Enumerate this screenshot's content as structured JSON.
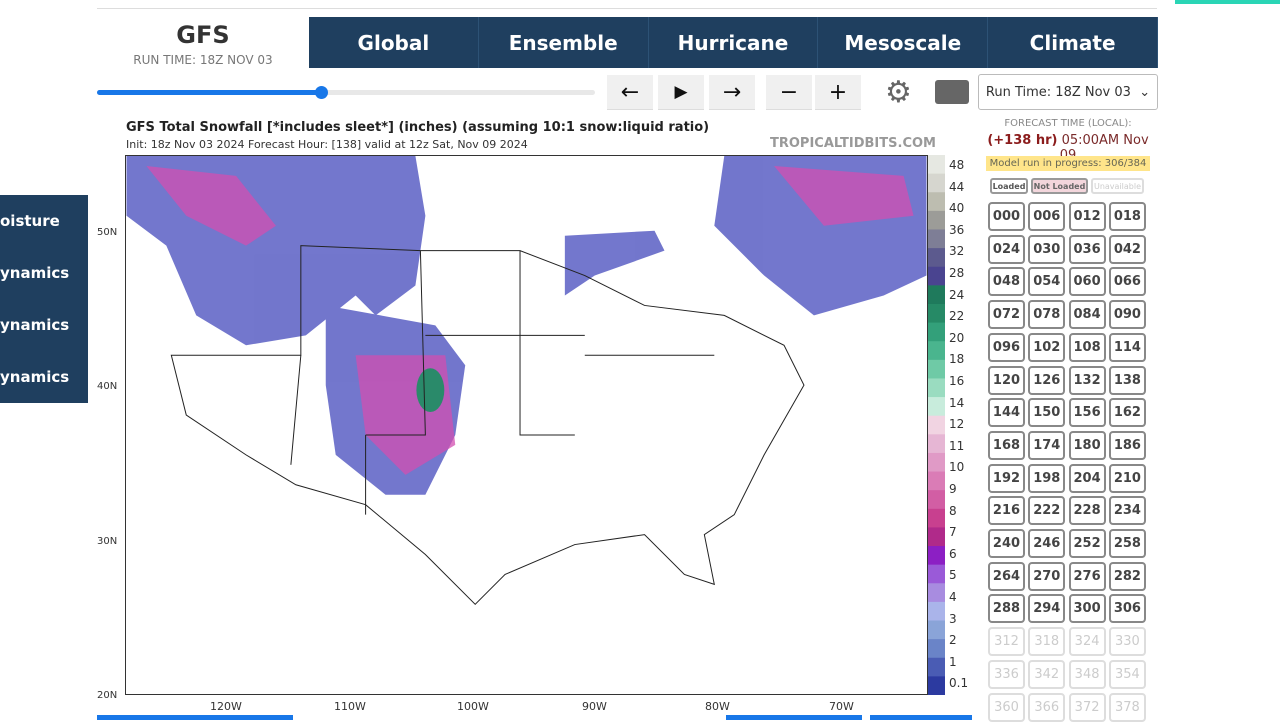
{
  "header": {
    "model": "GFS",
    "run_time": "RUN TIME: 18Z NOV 03"
  },
  "nav": [
    "Global",
    "Ensemble",
    "Hurricane",
    "Mesoscale",
    "Climate"
  ],
  "slider": {
    "progress_percent": 45
  },
  "controls": {
    "prev": "←",
    "play": "▶",
    "next": "→",
    "minus": "−",
    "plus": "+",
    "settings_icon": "gear-icon",
    "keyboard_icon": "keyboard-icon"
  },
  "run_select": "Run Time: 18Z Nov 03",
  "map": {
    "title": "GFS Total Snowfall [*includes sleet*] (inches) (assuming 10:1 snow:liquid ratio)",
    "subtitle": "Init: 18z Nov 03 2024   Forecast Hour: [138]   valid at 12z Sat, Nov 09 2024",
    "site": "TROPICALTIDBITS.COM",
    "lat_labels": [
      "50N",
      "40N",
      "30N",
      "20N"
    ],
    "lon_labels": [
      "120W",
      "110W",
      "100W",
      "90W",
      "80W",
      "70W"
    ],
    "colorbar_labels": [
      "48",
      "44",
      "40",
      "36",
      "32",
      "28",
      "24",
      "22",
      "20",
      "18",
      "16",
      "14",
      "12",
      "11",
      "10",
      "9",
      "8",
      "7",
      "6",
      "5",
      "4",
      "3",
      "2",
      "1",
      "0.1"
    ]
  },
  "forecast": {
    "label": "FORECAST TIME (LOCAL):",
    "hour": "(+138 hr)",
    "time": "05:00AM Nov 09",
    "progress": "Model run in progress: 306/384"
  },
  "legend": [
    "Loaded",
    "Not Loaded",
    "Unavailable"
  ],
  "hours_available": [
    "000",
    "006",
    "012",
    "018",
    "024",
    "030",
    "036",
    "042",
    "048",
    "054",
    "060",
    "066",
    "072",
    "078",
    "084",
    "090",
    "096",
    "102",
    "108",
    "114",
    "120",
    "126",
    "132",
    "138",
    "144",
    "150",
    "156",
    "162",
    "168",
    "174",
    "180",
    "186",
    "192",
    "198",
    "204",
    "210",
    "216",
    "222",
    "228",
    "234",
    "240",
    "246",
    "252",
    "258",
    "264",
    "270",
    "276",
    "282",
    "288",
    "294",
    "300",
    "306"
  ],
  "hours_unavailable": [
    "312",
    "318",
    "324",
    "330",
    "336",
    "342",
    "348",
    "354",
    "360",
    "366",
    "372",
    "378"
  ],
  "sidebar": [
    "oisture",
    "ynamics",
    "ynamics",
    "ynamics"
  ]
}
